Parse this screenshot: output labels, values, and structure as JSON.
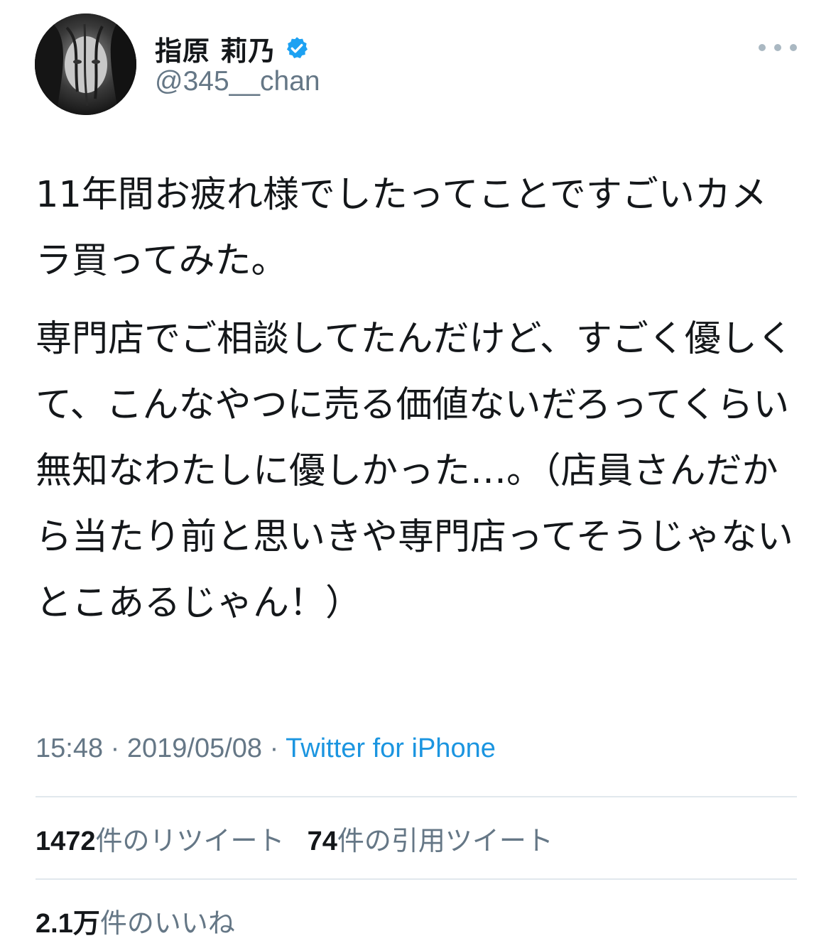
{
  "user": {
    "display_name": "指原 莉乃",
    "handle": "@345__chan",
    "verified_icon": "verified-badge-icon",
    "verified_color": "#1da1f2"
  },
  "more_icon": "more-horizontal-icon",
  "tweet": {
    "paragraph_1": "11年間お疲れ様でしたってことですごいカメラ買ってみた。",
    "paragraph_2": "専門店でご相談してたんだけど、すごく優しくて、こんなやつに売る価値ないだろってくらい無知なわたしに優しかった…。（店員さんだから当たり前と思いきや専門店ってそうじゃないとこあるじゃん！）"
  },
  "meta": {
    "time": "15:48",
    "separator_1": " · ",
    "date": "2019/05/08",
    "separator_2": " · ",
    "source": "Twitter for iPhone",
    "source_color": "#1b95e0"
  },
  "stats": {
    "retweets_count": "1472",
    "retweets_label": "件のリツイート",
    "quotes_count": "74",
    "quotes_label": "件の引用ツイート",
    "likes_count": "2.1万",
    "likes_label": "件のいいね"
  }
}
